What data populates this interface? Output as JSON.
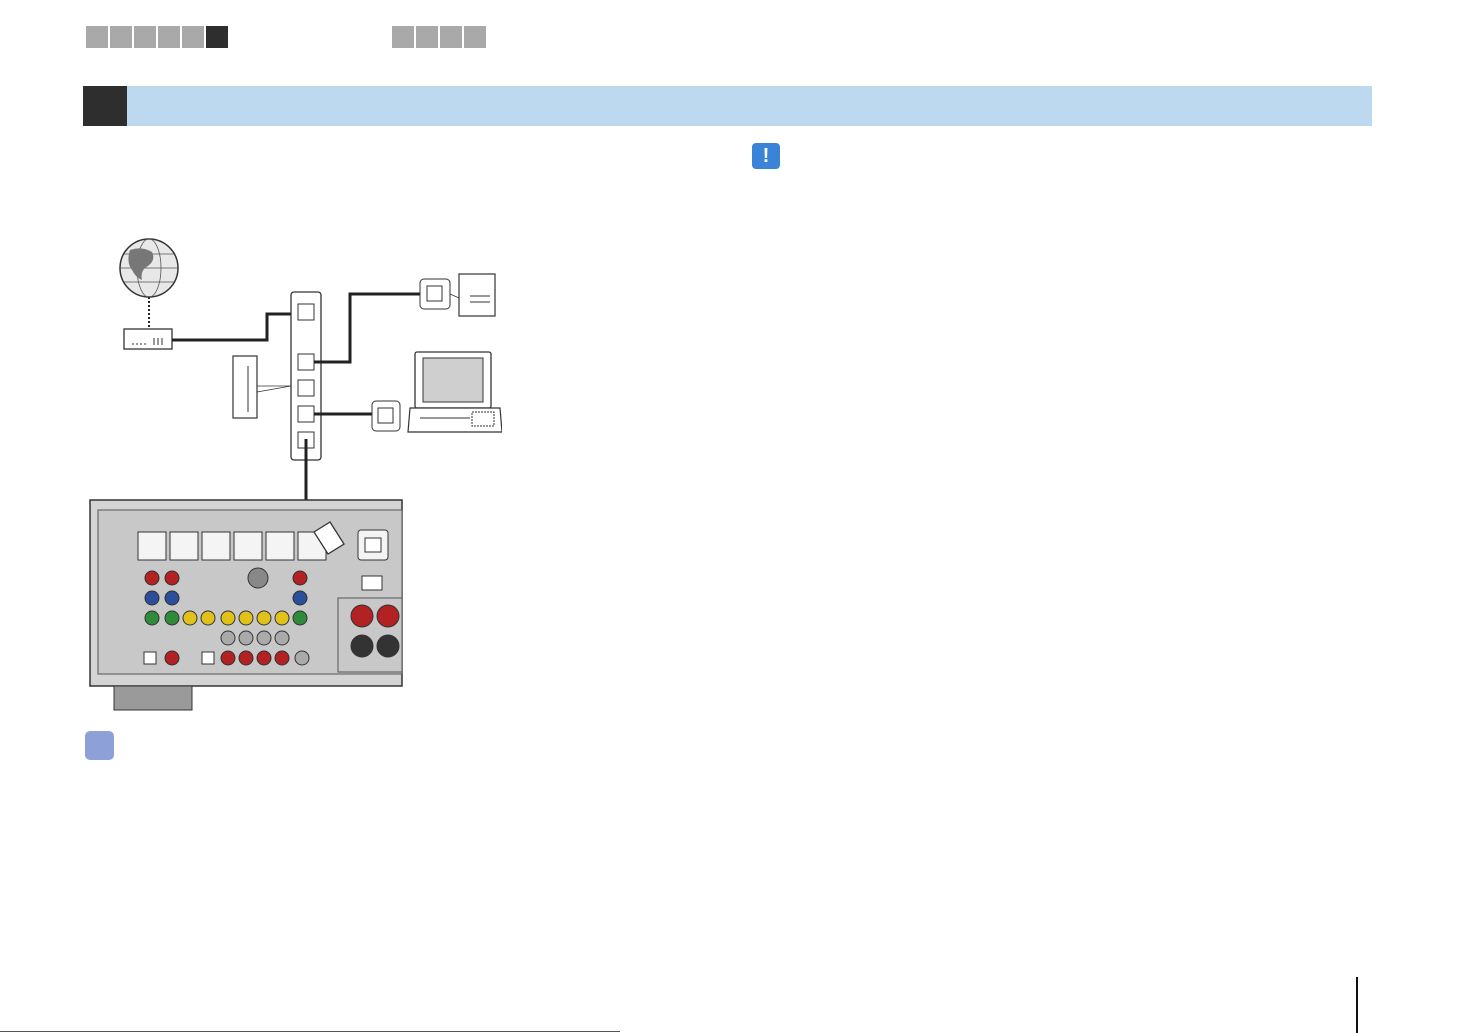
{
  "header": {
    "step_tabs": [
      "",
      "",
      "",
      "",
      "",
      ""
    ],
    "active_step_index": 5,
    "ref_tabs": [
      "",
      "",
      "",
      ""
    ]
  },
  "section": {
    "number": "",
    "title": ""
  },
  "icons": {
    "note": "caution-icon",
    "hint": "lightbulb-hint-icon",
    "internet": "globe-icon",
    "modem": "modem-icon",
    "router": "network-router-icon",
    "server": "network-storage-icon",
    "computer": "laptop-icon",
    "receiver": "av-receiver-rear-panel-icon"
  },
  "colors": {
    "section_bar": "#bdd9f0",
    "section_number_bg": "#2e2e2e",
    "note_icon": "#3a84d8",
    "hint_icon": "#8ea0d8",
    "tab_gray": "#a9a9a9",
    "tab_active": "#2e2e2e"
  },
  "page": {
    "number": ""
  }
}
